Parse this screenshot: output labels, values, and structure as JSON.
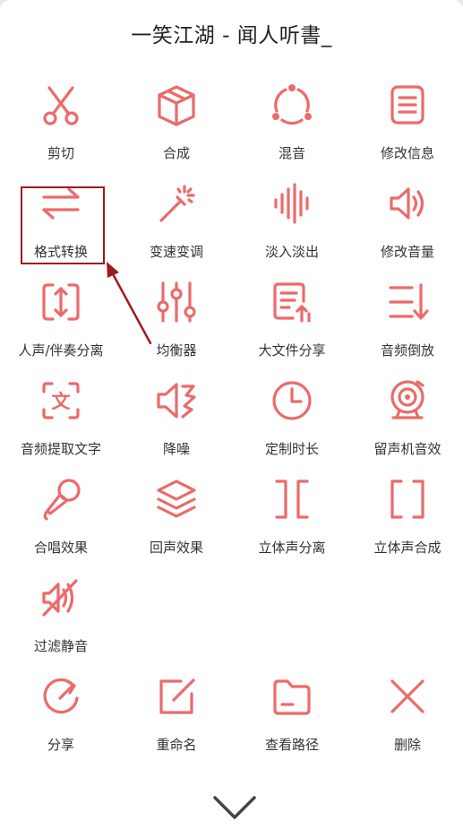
{
  "header": {
    "title": "一笑江湖 - 闻人听書_"
  },
  "colors": {
    "accent": "#ec6a6a",
    "highlight": "#a0191d"
  },
  "tools": [
    {
      "icon": "scissors-icon",
      "label": "剪切"
    },
    {
      "icon": "cube-icon",
      "label": "合成"
    },
    {
      "icon": "mix-circle-icon",
      "label": "混音"
    },
    {
      "icon": "document-lines-icon",
      "label": "修改信息"
    },
    {
      "icon": "swap-arrows-icon",
      "label": "格式转换"
    },
    {
      "icon": "magic-wand-icon",
      "label": "变速变调"
    },
    {
      "icon": "waveform-icon",
      "label": "淡入淡出"
    },
    {
      "icon": "speaker-icon",
      "label": "修改音量"
    },
    {
      "icon": "expand-vertical-icon",
      "label": "人声/伴奏分离"
    },
    {
      "icon": "equalizer-sliders-icon",
      "label": "均衡器"
    },
    {
      "icon": "file-share-icon",
      "label": "大文件分享"
    },
    {
      "icon": "reverse-list-icon",
      "label": "音频倒放"
    },
    {
      "icon": "text-scan-icon",
      "label": "音频提取文字"
    },
    {
      "icon": "noise-reduce-speaker-icon",
      "label": "降噪"
    },
    {
      "icon": "clock-icon",
      "label": "定制时长"
    },
    {
      "icon": "gramophone-icon",
      "label": "留声机音效"
    },
    {
      "icon": "microphone-icon",
      "label": "合唱效果"
    },
    {
      "icon": "layers-icon",
      "label": "回声效果"
    },
    {
      "icon": "split-brackets-icon",
      "label": "立体声分离"
    },
    {
      "icon": "merge-brackets-icon",
      "label": "立体声合成"
    },
    {
      "icon": "filter-muted-icon",
      "label": "过滤静音"
    }
  ],
  "actions": [
    {
      "icon": "share-icon",
      "label": "分享"
    },
    {
      "icon": "edit-icon",
      "label": "重命名"
    },
    {
      "icon": "folder-icon",
      "label": "查看路径"
    },
    {
      "icon": "close-x-icon",
      "label": "删除"
    }
  ],
  "footer": {
    "icon": "chevron-down-icon"
  }
}
